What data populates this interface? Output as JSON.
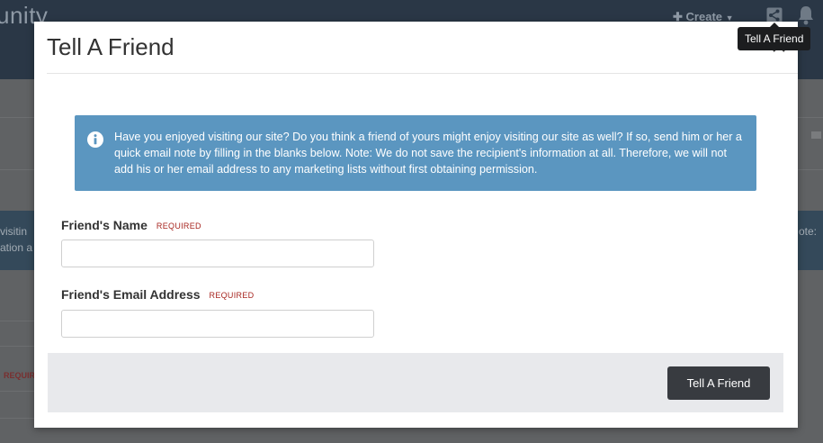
{
  "background": {
    "brand": "unity",
    "create_label": "Create",
    "snippet_1": "visitin",
    "snippet_2": "ation a",
    "snippet_3": "ote:",
    "req_fragment": "REQUIR"
  },
  "tooltip": {
    "text": "Tell A Friend"
  },
  "modal": {
    "title": "Tell A Friend",
    "alert_text": "Have you enjoyed visiting our site? Do you think a friend of yours might enjoy visiting our site as well? If so, send him or her a quick email note by filling in the blanks below. Note: We do not save the recipient's information at all. Therefore, we will not add his or her email address to any marketing lists without first obtaining permission.",
    "fields": [
      {
        "label": "Friend's Name",
        "required": "REQUIRED",
        "value": ""
      },
      {
        "label": "Friend's Email Address",
        "required": "REQUIRED",
        "value": ""
      }
    ],
    "submit_label": "Tell A Friend"
  },
  "colors": {
    "alert_bg": "#5b96c0",
    "button_bg": "#383b40",
    "required": "#a7251f",
    "topbar": "#2a3746"
  }
}
